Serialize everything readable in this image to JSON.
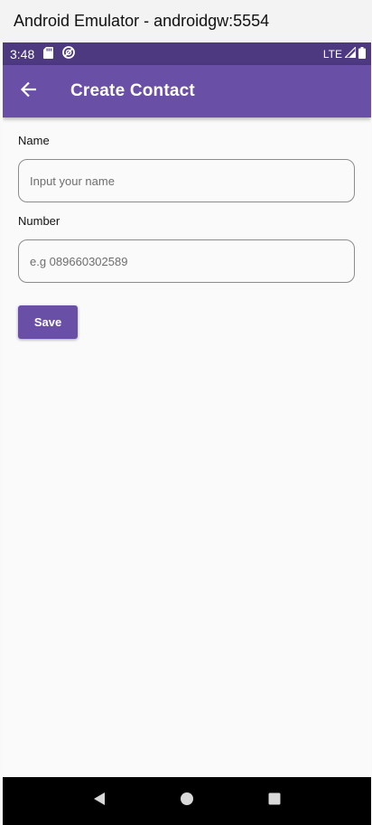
{
  "window": {
    "title": "Android Emulator - androidgw:5554"
  },
  "status_bar": {
    "time": "3:48",
    "icons_left": [
      "sd-card-icon",
      "do-not-disturb-icon"
    ],
    "network": "LTE",
    "icons_right": [
      "signal-icon",
      "battery-icon"
    ]
  },
  "app_bar": {
    "back_icon": "arrow-back-icon",
    "title": "Create Contact"
  },
  "form": {
    "name_label": "Name",
    "name_value": "",
    "name_placeholder": "Input your name",
    "number_label": "Number",
    "number_value": "",
    "number_placeholder": "e.g 089660302589",
    "save_label": "Save"
  },
  "nav_bar": {
    "buttons": [
      "back-triangle-icon",
      "home-circle-icon",
      "recents-square-icon"
    ]
  },
  "colors": {
    "status_bar": "#4d3980",
    "app_bar": "#6a4fa6",
    "button": "#6a4fa6",
    "background": "#fafafa",
    "nav_bar": "#000000"
  }
}
